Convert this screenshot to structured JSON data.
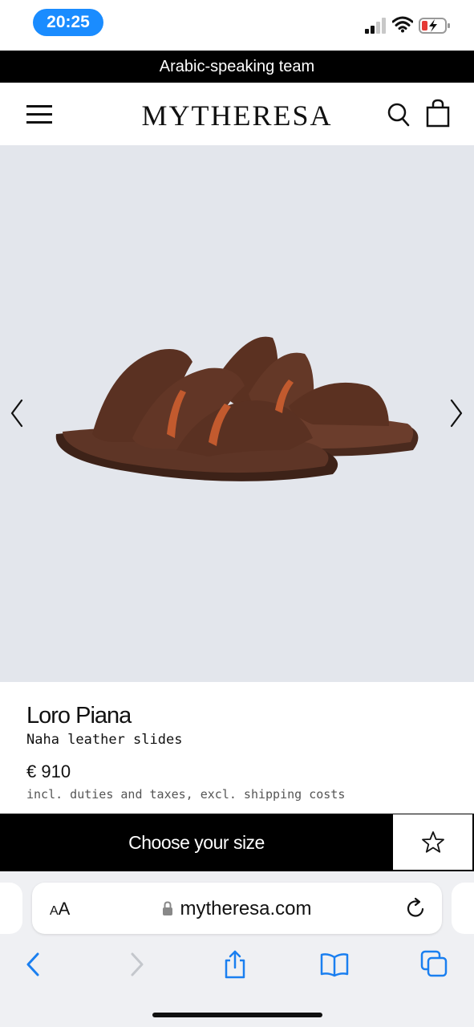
{
  "status_bar": {
    "time": "20:25"
  },
  "promo": {
    "text": "Arabic-speaking team"
  },
  "header": {
    "logo": "MYTHERESA",
    "icons": [
      "menu-icon",
      "search-icon",
      "shopping-bag-icon"
    ]
  },
  "gallery": {
    "image_alt": "brown leather slides",
    "icons": [
      "chevron-left-icon",
      "chevron-right-icon"
    ]
  },
  "product": {
    "brand": "Loro Piana",
    "name": "Naha leather slides",
    "price": "€ 910",
    "tax_note": "incl. duties and taxes, excl. shipping costs"
  },
  "cta": {
    "size_label": "Choose your size",
    "wishlist_icon": "star-icon"
  },
  "browser": {
    "aa_big": "A",
    "aa_small": "A",
    "aa_prefix": "A",
    "url": "mytheresa.com",
    "toolbar_icons": [
      "back-icon",
      "forward-icon",
      "share-icon",
      "bookmarks-icon",
      "tabs-icon"
    ]
  },
  "colors": {
    "accent_blue": "#1a8cff",
    "banner_black": "#000000",
    "gallery_bg": "#e3e6ec",
    "leather_brown": "#5a3325"
  }
}
